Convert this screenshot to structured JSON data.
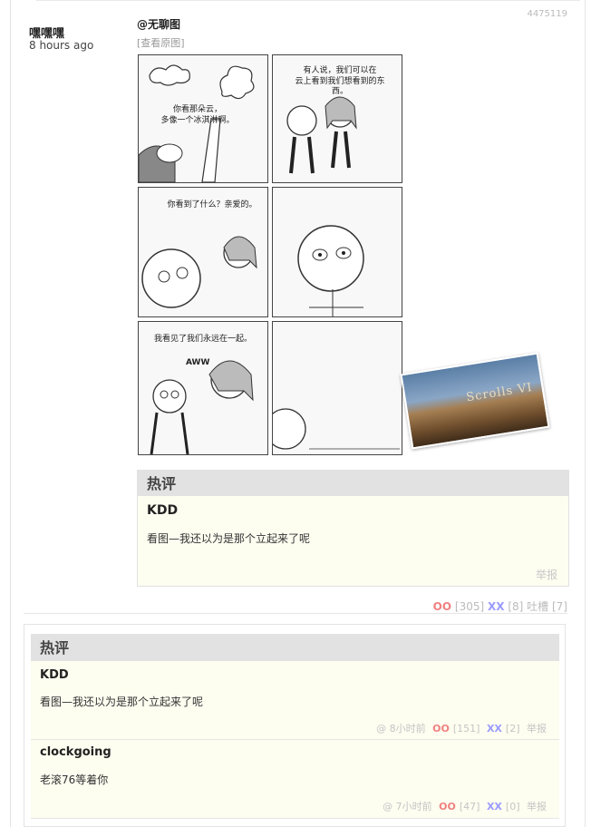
{
  "post": {
    "id": "4475119",
    "author": "嘿嘿嘿",
    "time": "8 hours ago",
    "at_tag": "@无聊图",
    "view_original": "[查看原图]"
  },
  "comic": {
    "captions": [
      "你看那朵云，\n多像一个冰淇淋啊。",
      "有人说，我们可以在\n云上看到我们想看到的东西。",
      "你看到了什么？亲爱的。",
      "我看见了我们永远在一起。",
      "AWW",
      "Scrolls VI"
    ]
  },
  "hot_inline": {
    "title": "热评",
    "user": "KDD",
    "text": "看图—我还以为是那个立起来了呢",
    "report": "举报"
  },
  "votes": {
    "oo_label": "OO",
    "oo_count": "[305]",
    "xx_label": "XX",
    "xx_count": "[8]",
    "tucao": "吐槽 [7]"
  },
  "hot_section": {
    "title": "热评",
    "comments": [
      {
        "user": "KDD",
        "text": "看图—我还以为是那个立起来了呢",
        "time": "@ 8小时前",
        "oo_label": "OO",
        "oo_count": "[151]",
        "xx_label": "XX",
        "xx_count": "[2]",
        "report": "举报"
      },
      {
        "user": "clockgoing",
        "text": "老滚76等着你",
        "time": "@ 7小时前",
        "oo_label": "OO",
        "oo_count": "[47]",
        "xx_label": "XX",
        "xx_count": "[0]",
        "report": "举报"
      }
    ]
  }
}
